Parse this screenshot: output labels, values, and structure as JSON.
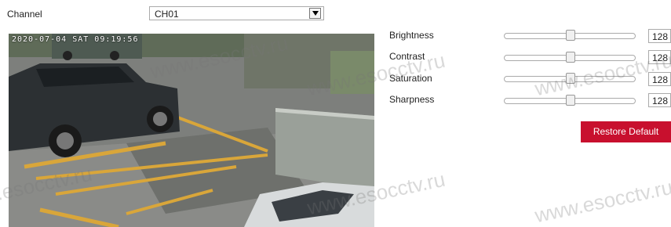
{
  "channel": {
    "label": "Channel",
    "selected": "CH01"
  },
  "preview": {
    "osd_timestamp": "2020-07-04  SAT  09:19:56"
  },
  "settings": [
    {
      "label": "Brightness",
      "value": "128"
    },
    {
      "label": "Contrast",
      "value": "128"
    },
    {
      "label": "Saturation",
      "value": "128"
    },
    {
      "label": "Sharpness",
      "value": "128"
    }
  ],
  "slider_level": 0.5,
  "restore_label": "Restore Default",
  "watermarks": [
    "www.esocctv.ru",
    "www.esocctv.ru",
    "www.esocctv.ru",
    "www.esocctv.ru",
    "www.esocctv.ru",
    "www.esocctv.ru"
  ],
  "colors": {
    "accent": "#c8102e"
  }
}
